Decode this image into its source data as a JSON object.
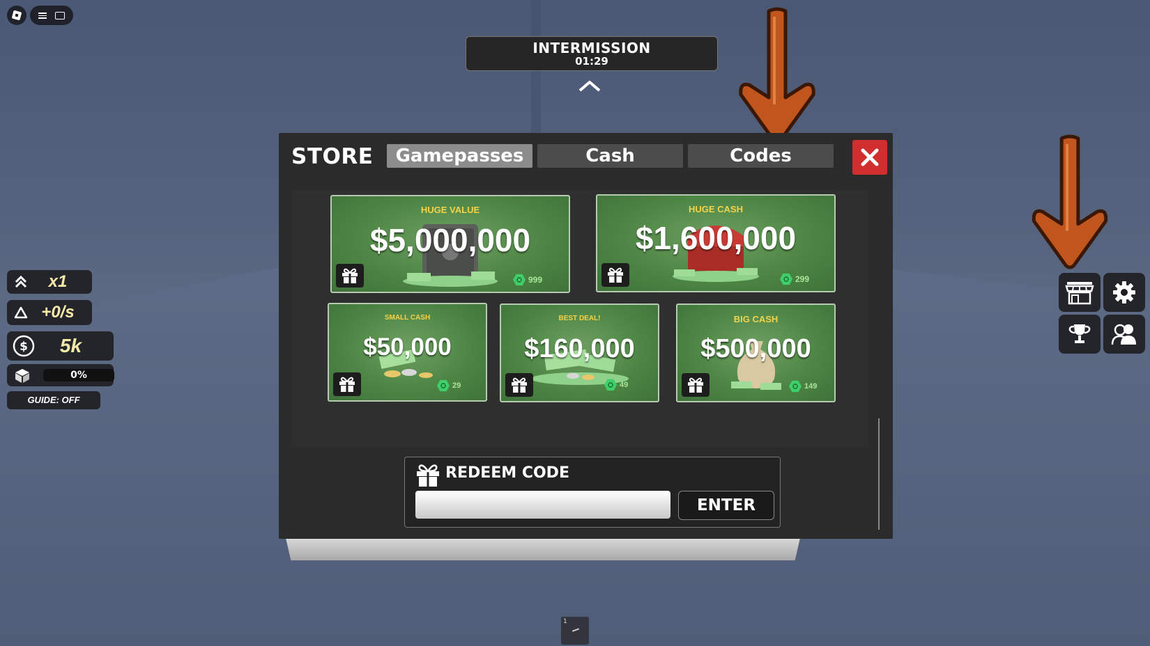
{
  "topbar": {
    "logo_icon": "roblox-logo-icon",
    "menu_icon": "hamburger-icon",
    "chat_icon": "chat-icon"
  },
  "intermission": {
    "title": "INTERMISSION",
    "timer": "01:29"
  },
  "hud": {
    "multiplier": "x1",
    "rate": "+0/s",
    "cash": "5k",
    "progress": "0%",
    "guide": "GUIDE: OFF"
  },
  "store": {
    "title": "STORE",
    "tabs": [
      "Gamepasses",
      "Cash",
      "Codes"
    ],
    "active_tab": "Gamepasses",
    "cards": [
      {
        "label": "HUGE VALUE",
        "amount": "$5,000,000",
        "price": "999"
      },
      {
        "label": "HUGE CASH",
        "amount": "$1,600,000",
        "price": "299"
      },
      {
        "label": "SMALL CASH",
        "amount": "$50,000",
        "price": "29"
      },
      {
        "label": "BEST DEAL!",
        "amount": "$160,000",
        "price": "49"
      },
      {
        "label": "BIG CASH",
        "amount": "$500,000",
        "price": "149"
      }
    ],
    "redeem": {
      "title": "REDEEM CODE",
      "input_value": "",
      "enter_label": "ENTER"
    }
  },
  "hotbar": {
    "slot_number": "1"
  },
  "colors": {
    "accent_close": "#d12f2f",
    "card_label": "#f3d34a",
    "arrow": "#c0561e"
  }
}
